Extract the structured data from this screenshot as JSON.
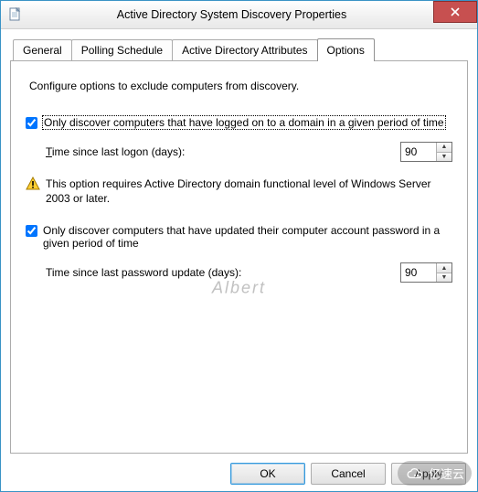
{
  "title": "Active Directory System Discovery Properties",
  "tabs": {
    "general": "General",
    "polling": "Polling Schedule",
    "attrs": "Active Directory Attributes",
    "options": "Options"
  },
  "selected_tab": "Options",
  "instructions": "Configure options to exclude computers from discovery.",
  "opt1_label": "Only discover computers that have logged on to a domain in a given period of time",
  "opt1_checked": true,
  "opt1_time_label_pre": "T",
  "opt1_time_label_post": "ime since last logon (days):",
  "opt1_value": "90",
  "warning_text": "This option requires Active Directory domain functional level of Windows Server 2003 or later.",
  "opt2_label": "Only discover computers that have updated their computer account password in a given period of time",
  "opt2_checked": true,
  "opt2_time_label": "Time since last password update (days):",
  "opt2_value": "90",
  "buttons": {
    "ok": "OK",
    "cancel": "Cancel",
    "apply": "Apply"
  },
  "watermark": "Albert",
  "brand_text": "亿速云"
}
